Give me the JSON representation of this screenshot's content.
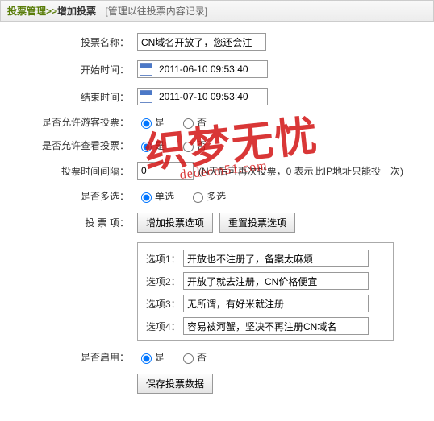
{
  "breadcrumb": {
    "section": "投票管理",
    "current": "增加投票",
    "note": "[管理以往投票内容记录]"
  },
  "labels": {
    "title": "投票名称：",
    "start": "开始时间：",
    "end": "结束时间：",
    "allowGuest": "是否允许游客投票：",
    "allowView": "是否允许查看投票：",
    "interval": "投票时间间隔：",
    "multi": "是否多选：",
    "options": "投  票  项：",
    "enable": "是否启用："
  },
  "values": {
    "title": "CN域名开放了，您还会注",
    "start": "2011-06-10 09:53:40",
    "end": "2011-07-10 09:53:40",
    "interval": "0",
    "intervalHint": "(N天后可再次投票，0 表示此IP地址只能投一次)"
  },
  "radios": {
    "yes": "是",
    "no": "否",
    "single": "单选",
    "multi": "多选"
  },
  "buttons": {
    "addOption": "增加投票选项",
    "resetOption": "重置投票选项",
    "save": "保存投票数据"
  },
  "options": [
    {
      "label": "选项1：",
      "value": "开放也不注册了，备案太麻烦"
    },
    {
      "label": "选项2：",
      "value": "开放了就去注册，CN价格便宜"
    },
    {
      "label": "选项3：",
      "value": "无所谓，有好米就注册"
    },
    {
      "label": "选项4：",
      "value": "容易被河蟹，坚决不再注册CN域名"
    }
  ],
  "watermark": {
    "main": "织梦无忧",
    "sub": "dedecm51.com"
  }
}
